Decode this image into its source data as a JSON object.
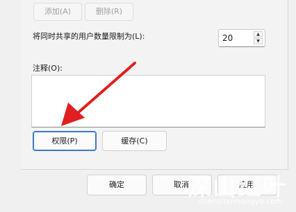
{
  "buttons": {
    "add": "添加(A)",
    "remove": "删除(R)",
    "permissions": "权限(P)",
    "caching": "缓存(C)",
    "ok": "确定",
    "cancel": "取消",
    "apply": "应用"
  },
  "limit_label": "将同时共享的用户数量限制为(L):",
  "limit_value": "20",
  "comment_label": "注释(O):",
  "watermark": {
    "main": "深山红叶",
    "sub": "shenshanhongye.com"
  },
  "colors": {
    "arrow": "#e02020",
    "focus_border": "#3b78c4"
  }
}
